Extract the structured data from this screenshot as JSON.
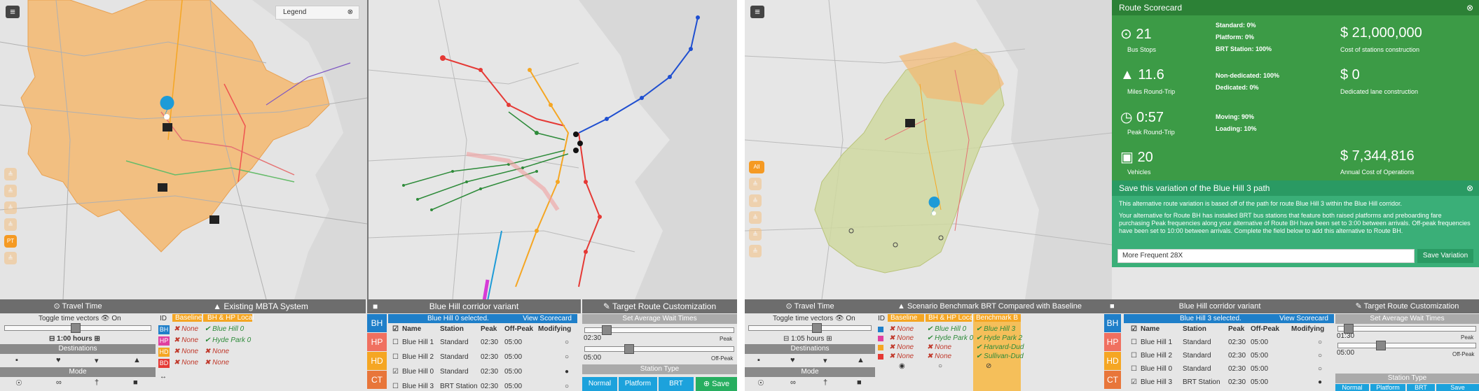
{
  "legend": {
    "label": "Legend",
    "close": "⊗"
  },
  "menu_icon": "≡",
  "mode_chips_left": [
    "≜",
    "≜",
    "≜",
    "≜",
    "PT",
    "≜"
  ],
  "mode_chips_right": [
    "All",
    "≜",
    "≜",
    "≜",
    "≜",
    "≜"
  ],
  "left": {
    "travel_time": {
      "title": "⊙ Travel Time",
      "toggle": "Toggle time vectors 👁 On",
      "hours": "1:00 hours",
      "destinations": "Destinations",
      "mode": "Mode"
    },
    "existing": {
      "title": "Existing MBTA System",
      "col_id": "ID",
      "col_baseline": "Baseline",
      "col_bh": "BH & HP Local",
      "ids": [
        "BH",
        "HP",
        "HD",
        "BD"
      ],
      "id_colors": [
        "#1f7fc9",
        "#e040a0",
        "#f5a623",
        "#e53935"
      ],
      "baseline": [
        "None",
        "None",
        "None",
        "None"
      ],
      "bh_local": [
        "Blue Hill 0",
        "Hyde Park 0",
        "None",
        "None"
      ],
      "bh_local_ok": [
        true,
        true,
        false,
        false
      ]
    },
    "corridor": {
      "title": "Blue Hill corridor variant",
      "selected": "Blue Hill 0 selected.",
      "view_scorecard": "View Scorecard",
      "headers": [
        "Name",
        "Station",
        "Peak",
        "Off-Peak",
        "Modifying"
      ],
      "rows": [
        {
          "name": "Blue Hill 1",
          "station": "Standard",
          "peak": "02:30",
          "off": "05:00",
          "checked": false
        },
        {
          "name": "Blue Hill 2",
          "station": "Standard",
          "peak": "02:30",
          "off": "05:00",
          "checked": false
        },
        {
          "name": "Blue Hill 0",
          "station": "Standard",
          "peak": "02:30",
          "off": "05:00",
          "checked": true
        },
        {
          "name": "Blue Hill 3",
          "station": "BRT Station",
          "peak": "02:30",
          "off": "05:00",
          "checked": false
        }
      ],
      "tabs": [
        "BH",
        "HP",
        "HD",
        "CT"
      ],
      "tab_colors": [
        "#1f7fc9",
        "#f07060",
        "#f5a623",
        "#e8763a"
      ]
    },
    "customization": {
      "title": "Target Route Customization",
      "wait": "Set Average Wait Times",
      "peak_value": "02:30",
      "peak_label": "Peak",
      "off_value": "05:00",
      "off_label": "Off-Peak",
      "station_type": "Station Type",
      "buttons": [
        "Normal",
        "Platform",
        "BRT"
      ],
      "save": "Save"
    }
  },
  "right": {
    "travel_time": {
      "title": "⊙ Travel Time",
      "toggle": "Toggle time vectors 👁 On",
      "hours": "1:05 hours",
      "destinations": "Destinations",
      "mode": "Mode"
    },
    "scenario": {
      "title": "Scenario Benchmark BRT Compared with Baseline",
      "col_id": "ID",
      "col_baseline": "Baseline",
      "col_bh": "BH & HP Local",
      "col_bench": "Benchmark B",
      "id_colors": [
        "#1f7fc9",
        "#e040a0",
        "#f5a623",
        "#e53935"
      ],
      "baseline": [
        "None",
        "None",
        "None",
        "None"
      ],
      "bh_local": [
        "Blue Hill 0",
        "Hyde Park 0",
        "None",
        "None"
      ],
      "bh_local_ok": [
        true,
        true,
        false,
        false
      ],
      "bench": [
        "Blue Hill 3",
        "Hyde Park 2",
        "Harvard-Dud",
        "Sullivan-Dud"
      ]
    },
    "corridor": {
      "title": "Blue Hill corridor variant",
      "selected": "Blue Hill 3 selected.",
      "view_scorecard": "View Scorecard",
      "headers": [
        "Name",
        "Station",
        "Peak",
        "Off-Peak",
        "Modifying"
      ],
      "rows": [
        {
          "name": "Blue Hill 1",
          "station": "Standard",
          "peak": "02:30",
          "off": "05:00",
          "checked": false
        },
        {
          "name": "Blue Hill 2",
          "station": "Standard",
          "peak": "02:30",
          "off": "05:00",
          "checked": false
        },
        {
          "name": "Blue Hill 0",
          "station": "Standard",
          "peak": "02:30",
          "off": "05:00",
          "checked": false
        },
        {
          "name": "Blue Hill 3",
          "station": "BRT Station",
          "peak": "02:30",
          "off": "05:00",
          "checked": true
        }
      ],
      "tabs": [
        "BH",
        "HP",
        "HD",
        "CT"
      ]
    },
    "customization": {
      "title": "Target Route Customization",
      "wait": "Set Average Wait Times",
      "peak_value": "01:30",
      "peak_label": "Peak",
      "off_value": "05:00",
      "off_label": "Off-Peak",
      "station_type": "Station Type",
      "buttons": [
        "Normal",
        "Platform",
        "BRT"
      ],
      "save": "Save"
    },
    "scorecard": {
      "title": "Route Scorecard",
      "bus_stops": "21",
      "bus_stops_label": "Bus Stops",
      "miles": "11.6",
      "miles_label": "Miles Round-Trip",
      "peak_rt": "0:57",
      "peak_rt_label": "Peak Round-Trip",
      "vehicles": "20",
      "vehicles_label": "Vehicles",
      "standard": "Standard: 0%",
      "platform": "Platform: 0%",
      "brt": "BRT Station: 100%",
      "nondedicated": "Non-dedicated: 100%",
      "dedicated": "Dedicated: 0%",
      "moving": "Moving: 90%",
      "loading": "Loading: 10%",
      "cost_stations": "$ 21,000,000",
      "cost_stations_label": "Cost of stations construction",
      "cost_lane": "$ 0",
      "cost_lane_label": "Dedicated lane construction",
      "cost_ops": "$ 7,344,816",
      "cost_ops_label": "Annual Cost of Operations"
    },
    "save_variation": {
      "title": "Save this variation of the Blue Hill 3 path",
      "p1": "This alternative route variation is based off of the path for route Blue Hill 3 within the Blue Hill corridor.",
      "p2": "Your alternative for Route BH has installed BRT bus stations that feature both raised platforms and preboarding fare purchasing Peak frequencies along your alternative of Route BH have been set to 3:00 between arrivals. Off-peak frequencies have been set to 10:00 between arrivals. Complete the field below to add this alternative to Route BH.",
      "input_value": "More Frequent 28X",
      "button": "Save Variation"
    }
  }
}
